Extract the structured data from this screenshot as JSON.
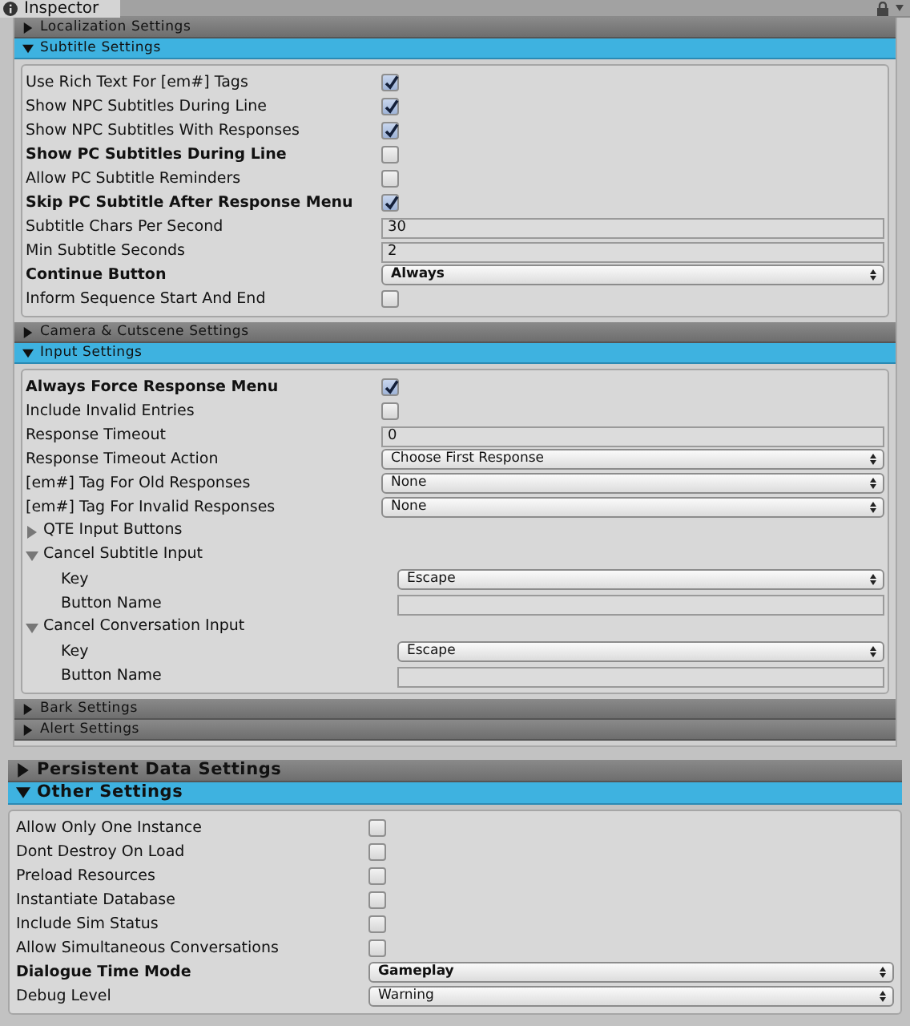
{
  "window": {
    "tab": "Inspector"
  },
  "sections": [
    {
      "kind": "minor",
      "title": "Localization Settings",
      "expanded": false
    },
    {
      "kind": "minor",
      "title": "Subtitle Settings",
      "expanded": true,
      "fields": [
        {
          "kind": "checkbox",
          "label": "Use Rich Text For [em#] Tags",
          "bold": false,
          "checked": true
        },
        {
          "kind": "checkbox",
          "label": "Show NPC Subtitles During Line",
          "bold": false,
          "checked": true
        },
        {
          "kind": "checkbox",
          "label": "Show NPC Subtitles With Responses",
          "bold": false,
          "checked": true
        },
        {
          "kind": "checkbox",
          "label": "Show PC Subtitles During Line",
          "bold": true,
          "checked": false
        },
        {
          "kind": "checkbox",
          "label": "Allow PC Subtitle Reminders",
          "bold": false,
          "checked": false
        },
        {
          "kind": "checkbox",
          "label": "Skip PC Subtitle After Response Menu",
          "bold": true,
          "checked": true
        },
        {
          "kind": "text",
          "label": "Subtitle Chars Per Second",
          "bold": false,
          "value": "30"
        },
        {
          "kind": "text",
          "label": "Min Subtitle Seconds",
          "bold": false,
          "value": "2"
        },
        {
          "kind": "dropdown",
          "label": "Continue Button",
          "bold": true,
          "value": "Always"
        },
        {
          "kind": "checkbox",
          "label": "Inform Sequence Start And End",
          "bold": false,
          "checked": false
        }
      ]
    },
    {
      "kind": "minor",
      "title": "Camera & Cutscene Settings",
      "expanded": false
    },
    {
      "kind": "minor",
      "title": "Input Settings",
      "expanded": true,
      "fields": [
        {
          "kind": "checkbox",
          "label": "Always Force Response Menu",
          "bold": true,
          "checked": true
        },
        {
          "kind": "checkbox",
          "label": "Include Invalid Entries",
          "bold": false,
          "checked": false
        },
        {
          "kind": "text",
          "label": "Response Timeout",
          "bold": false,
          "value": "0"
        },
        {
          "kind": "dropdown",
          "label": "Response Timeout Action",
          "bold": false,
          "value": "Choose First Response"
        },
        {
          "kind": "dropdown",
          "label": "[em#] Tag For Old Responses",
          "bold": false,
          "value": "None"
        },
        {
          "kind": "dropdown",
          "label": "[em#] Tag For Invalid Responses",
          "bold": false,
          "value": "None"
        },
        {
          "kind": "foldout",
          "label": "QTE Input Buttons",
          "expanded": false
        },
        {
          "kind": "foldout",
          "label": "Cancel Subtitle Input",
          "expanded": true,
          "children": [
            {
              "kind": "dropdown",
              "label": "Key",
              "bold": false,
              "value": "Escape"
            },
            {
              "kind": "text",
              "label": "Button Name",
              "bold": false
            }
          ]
        },
        {
          "kind": "foldout",
          "label": "Cancel Conversation Input",
          "expanded": true,
          "children": [
            {
              "kind": "dropdown",
              "label": "Key",
              "bold": false,
              "value": "Escape"
            },
            {
              "kind": "text",
              "label": "Button Name",
              "bold": false
            }
          ]
        }
      ]
    },
    {
      "kind": "minor",
      "title": "Bark Settings",
      "expanded": false
    },
    {
      "kind": "minor",
      "title": "Alert Settings",
      "expanded": false
    },
    {
      "kind": "major",
      "title": "Persistent Data Settings",
      "expanded": false
    },
    {
      "kind": "major",
      "title": "Other Settings",
      "expanded": true,
      "fields": [
        {
          "kind": "checkbox",
          "label": "Allow Only One Instance",
          "bold": false,
          "checked": false
        },
        {
          "kind": "checkbox",
          "label": "Dont Destroy On Load",
          "bold": false,
          "checked": false
        },
        {
          "kind": "checkbox",
          "label": "Preload Resources",
          "bold": false,
          "checked": false
        },
        {
          "kind": "checkbox",
          "label": "Instantiate Database",
          "bold": false,
          "checked": false
        },
        {
          "kind": "checkbox",
          "label": "Include Sim Status",
          "bold": false,
          "checked": false
        },
        {
          "kind": "checkbox",
          "label": "Allow Simultaneous Conversations",
          "bold": false,
          "checked": false
        },
        {
          "kind": "dropdown",
          "label": "Dialogue Time Mode",
          "bold": true,
          "value": "Gameplay"
        },
        {
          "kind": "dropdown",
          "label": "Debug Level",
          "bold": false,
          "value": "Warning"
        }
      ]
    }
  ]
}
